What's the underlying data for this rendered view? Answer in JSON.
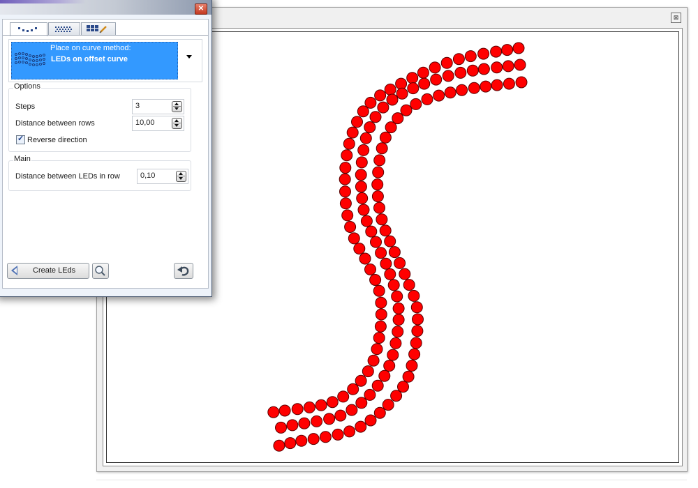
{
  "canvas": {
    "close_glyph": "⊠",
    "led_color": "#ff0000",
    "led_stroke": "#5a0000"
  },
  "panel": {
    "close_glyph": "✕",
    "tabs": [
      {
        "icon": "led-dots-icon",
        "active": true
      },
      {
        "icon": "led-grid-icon",
        "active": false
      },
      {
        "icon": "grid-pencil-icon",
        "active": false
      }
    ],
    "method": {
      "label": "Place on curve method:",
      "value": "LEDs on offset curve",
      "icon": "offset-curve-leds-icon",
      "highlight_color": "#3399ff"
    },
    "options": {
      "title": "Options",
      "steps_label": "Steps",
      "steps_value": "3",
      "distance_rows_label": "Distance between rows",
      "distance_rows_value": "10,00",
      "reverse_label": "Reverse direction",
      "reverse_checked": true
    },
    "main": {
      "title": "Main",
      "distance_leds_label": "Distance between LEDs in row",
      "distance_leds_value": "0,10"
    },
    "footer": {
      "create_label": "Create LEds",
      "search_icon": "magnifier-icon",
      "undo_icon": "undo-arrow-icon"
    }
  }
}
